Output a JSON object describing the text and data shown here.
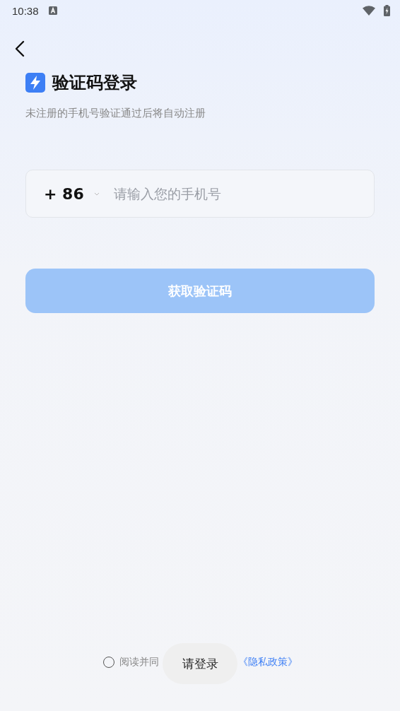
{
  "status_bar": {
    "time": "10:38"
  },
  "title": "验证码登录",
  "subtitle": "未注册的手机号验证通过后将自动注册",
  "phone_field": {
    "country_code": "+ 86",
    "placeholder": "请输入您的手机号"
  },
  "submit_button": {
    "label": "获取验证码",
    "disabled": true
  },
  "agreement": {
    "checked": false,
    "prefix": "阅读并同",
    "link": "《隐私政策》"
  },
  "toast": "请登录"
}
